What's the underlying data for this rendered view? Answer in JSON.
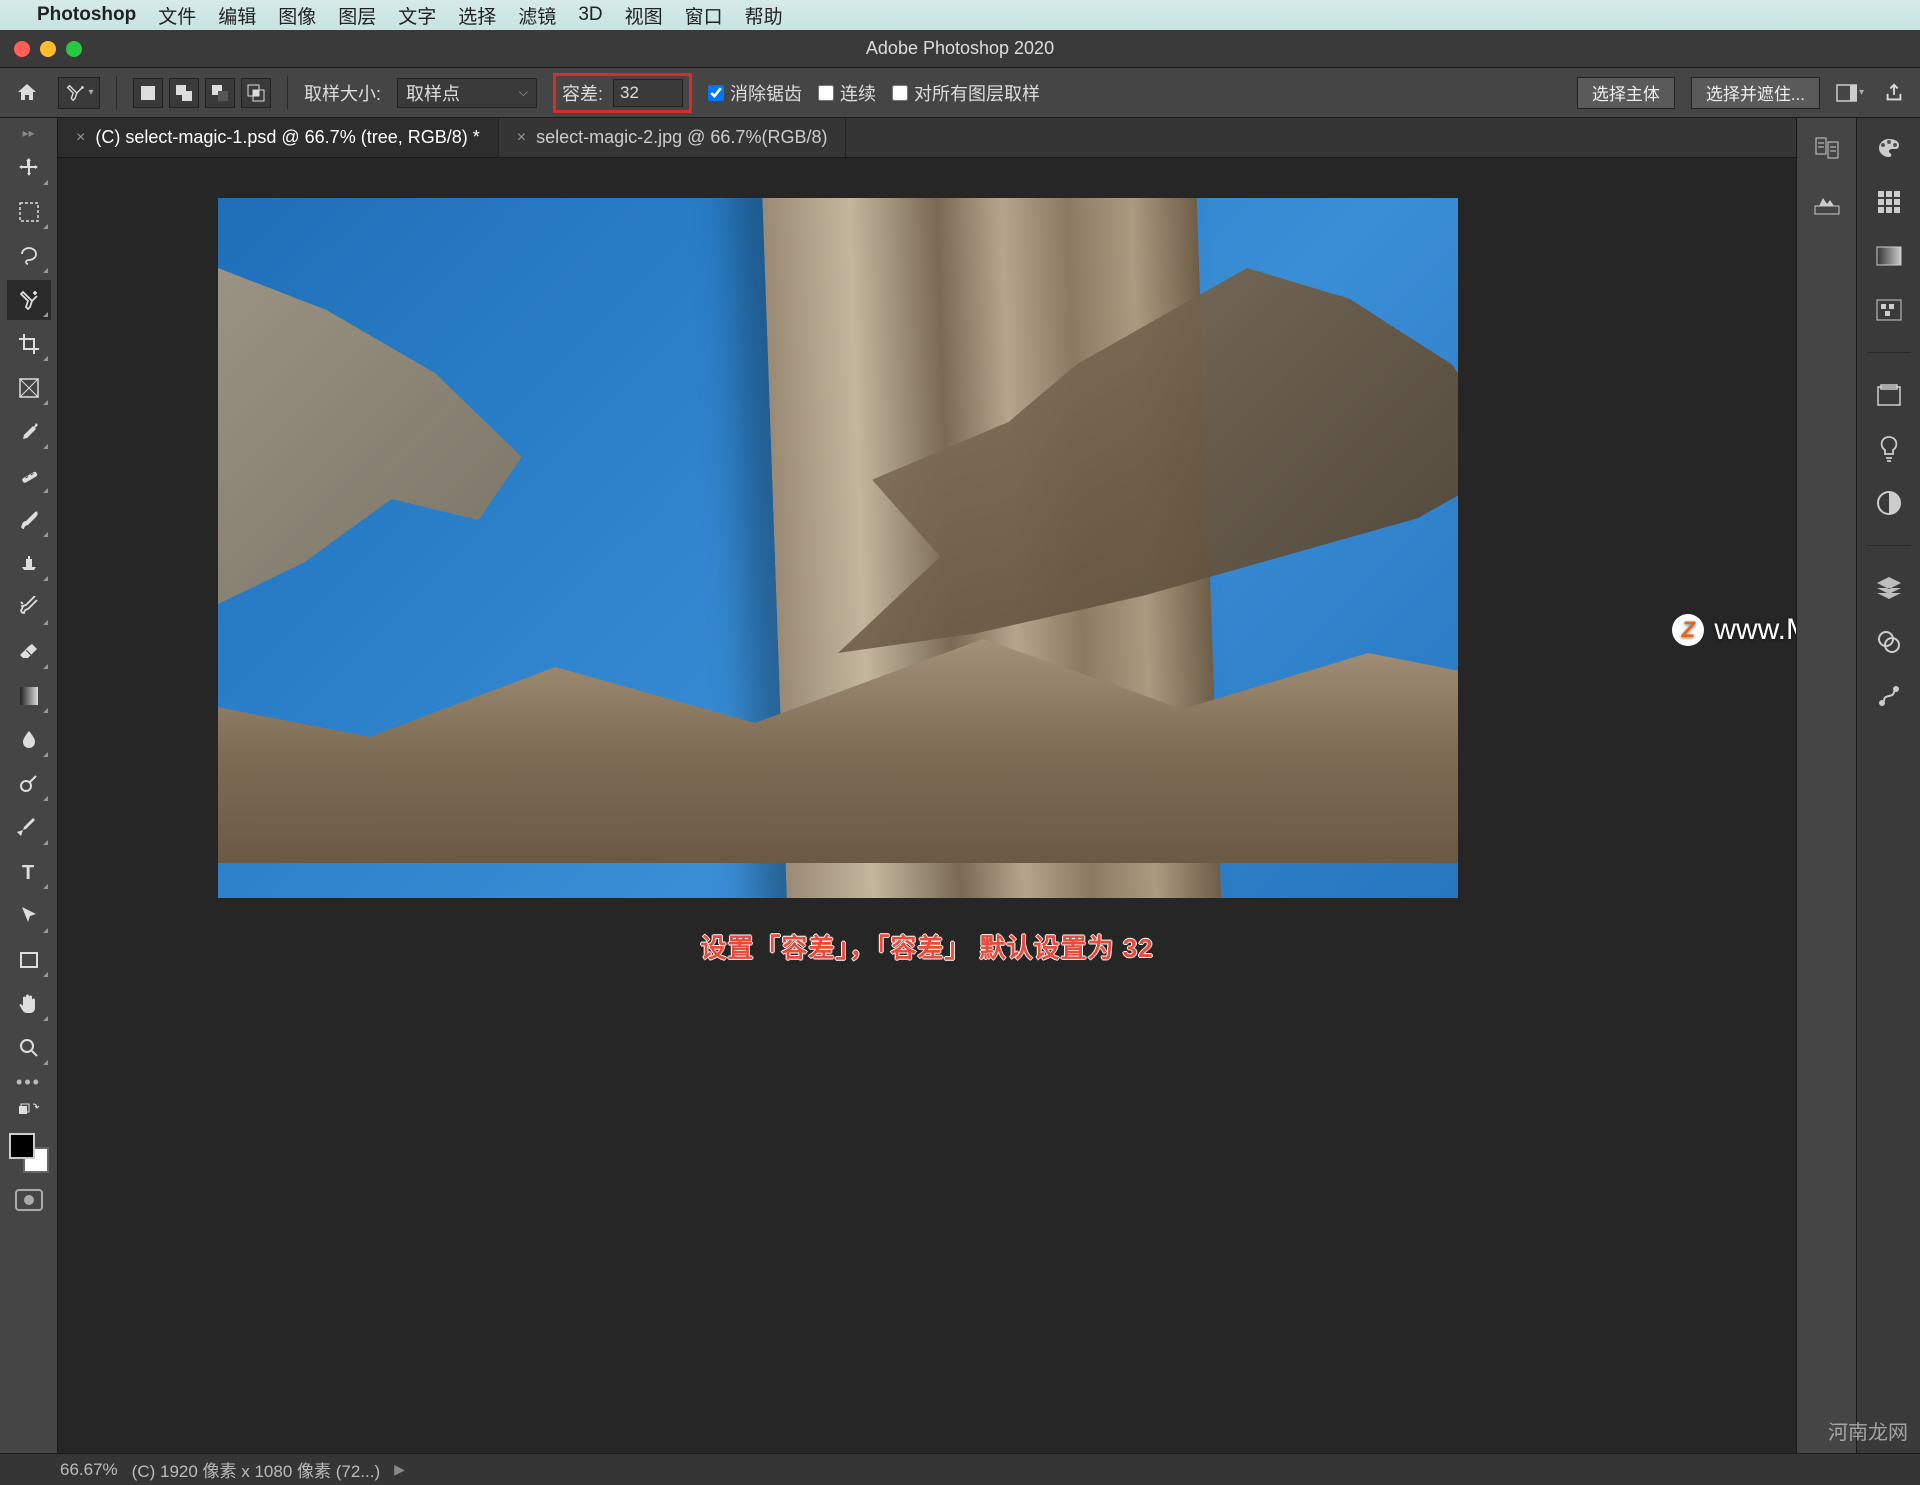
{
  "mac_menu": {
    "apple": "",
    "app": "Photoshop",
    "items": [
      "文件",
      "编辑",
      "图像",
      "图层",
      "文字",
      "选择",
      "滤镜",
      "3D",
      "视图",
      "窗口",
      "帮助"
    ]
  },
  "window": {
    "title": "Adobe Photoshop 2020"
  },
  "options": {
    "sample_label": "取样大小:",
    "sample_value": "取样点",
    "tolerance_label": "容差:",
    "tolerance_value": "32",
    "antialias": "消除锯齿",
    "contiguous": "连续",
    "all_layers": "对所有图层取样",
    "select_subject": "选择主体",
    "select_and_mask": "选择并遮住..."
  },
  "tabs": {
    "t1": "(C) select-magic-1.psd @ 66.7% (tree, RGB/8) *",
    "t2": "select-magic-2.jpg @ 66.7%(RGB/8)"
  },
  "caption": "设置「容差」，「容差」 默认设置为 32",
  "watermark": "www.MacZ.com",
  "watermark2": "河南龙网",
  "status": {
    "zoom": "66.67%",
    "doc": "(C) 1920 像素 x 1080 像素 (72...)"
  }
}
